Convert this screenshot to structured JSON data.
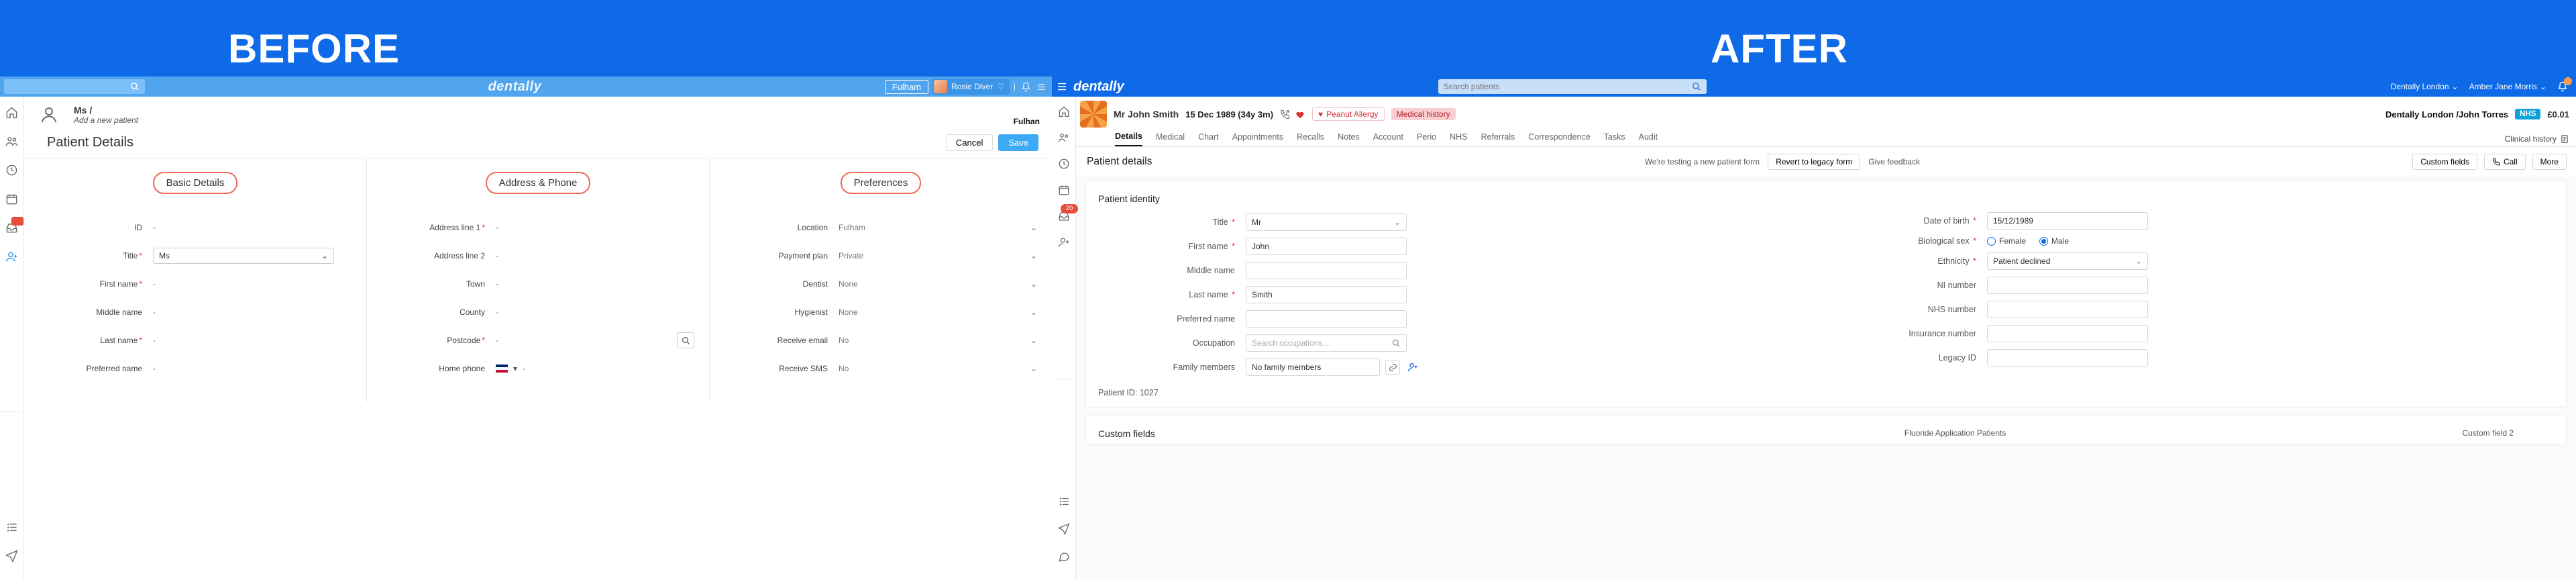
{
  "banner": {
    "before": "BEFORE",
    "after": "AFTER"
  },
  "before": {
    "brand": "dentally",
    "top": {
      "location_chip": "Fulham",
      "user_name": "Rosie Diver"
    },
    "crumb": {
      "title": "Ms /",
      "subtitle": "Add a new patient",
      "location_right": "Fulhan"
    },
    "details_heading": "Patient Details",
    "buttons": {
      "cancel": "Cancel",
      "save": "Save"
    },
    "cols": {
      "basic": {
        "heading": "Basic Details",
        "rows": {
          "id_label": "ID",
          "id_val": "-",
          "title_label": "Title",
          "title_val": "Ms",
          "first_label": "First name",
          "first_val": "-",
          "middle_label": "Middle name",
          "middle_val": "-",
          "last_label": "Last name",
          "last_val": "-",
          "pref_label": "Preferred name",
          "pref_val": "-"
        }
      },
      "address": {
        "heading": "Address & Phone",
        "rows": {
          "a1_label": "Address line 1",
          "a1_val": "-",
          "a2_label": "Address line 2",
          "a2_val": "-",
          "town_label": "Town",
          "town_val": "-",
          "county_label": "County",
          "county_val": "-",
          "pc_label": "Postcode",
          "pc_val": "-",
          "phone_label": "Home phone",
          "phone_val": "-"
        }
      },
      "prefs": {
        "heading": "Preferences",
        "rows": {
          "loc_label": "Location",
          "loc_val": "Fulham",
          "plan_label": "Payment plan",
          "plan_val": "Private",
          "dentist_label": "Dentist",
          "dentist_val": "None",
          "hyg_label": "Hygienist",
          "hyg_val": "None",
          "email_label": "Receive email",
          "email_val": "No",
          "sms_label": "Receive SMS",
          "sms_val": "No"
        }
      }
    }
  },
  "after": {
    "brand": "dentally",
    "search_placeholder": "Search patients",
    "top_right": {
      "location": "Dentally London",
      "user": "Amber Jane Morris"
    },
    "rail_badge": "20",
    "patient": {
      "name": "Mr John Smith",
      "dob_line": "15 Dec 1989 (34y 3m)",
      "allergy_chip": "Peanut Allergy",
      "medhist_chip": "Medical history",
      "loc_slash": "Dentally London /John Torres",
      "nhs": "NHS",
      "balance": "£0.01",
      "clinical": "Clinical history"
    },
    "tabs": [
      "Details",
      "Medical",
      "Chart",
      "Appointments",
      "Recalls",
      "Notes",
      "Account",
      "Perio",
      "NHS",
      "Referrals",
      "Correspondence",
      "Tasks",
      "Audit"
    ],
    "subbar": {
      "title": "Patient details",
      "testing_msg": "We're testing a new patient form",
      "revert_btn": "Revert to legacy form",
      "feedback": "Give feedback",
      "custom_btn": "Custom fields",
      "call_btn": "Call",
      "more_btn": "More"
    },
    "identity": {
      "heading": "Patient identity",
      "left": {
        "title_lab": "Title",
        "title_val": "Mr",
        "first_lab": "First name",
        "first_val": "John",
        "middle_lab": "Middle name",
        "middle_val": "",
        "last_lab": "Last name",
        "last_val": "Smith",
        "pref_lab": "Preferred name",
        "pref_val": "",
        "occ_lab": "Occupation",
        "occ_placeholder": "Search occupations...",
        "fam_lab": "Family members",
        "fam_val": "No family members",
        "pid_note": "Patient ID: 1027"
      },
      "right": {
        "dob_lab": "Date of birth",
        "dob_val": "15/12/1989",
        "sex_lab": "Biological sex",
        "sex_female": "Female",
        "sex_male": "Male",
        "eth_lab": "Ethnicity",
        "eth_val": "Patient declined",
        "ni_lab": "NI number",
        "ni_val": "",
        "nhs_lab": "NHS number",
        "nhs_val": "",
        "ins_lab": "Insurance number",
        "ins_val": "",
        "leg_lab": "Legacy ID",
        "leg_val": ""
      }
    },
    "custom_card": {
      "heading": "Custom fields",
      "f1_lab": "Fluoride Application Patients",
      "f2_lab": "Custom field 2"
    }
  }
}
